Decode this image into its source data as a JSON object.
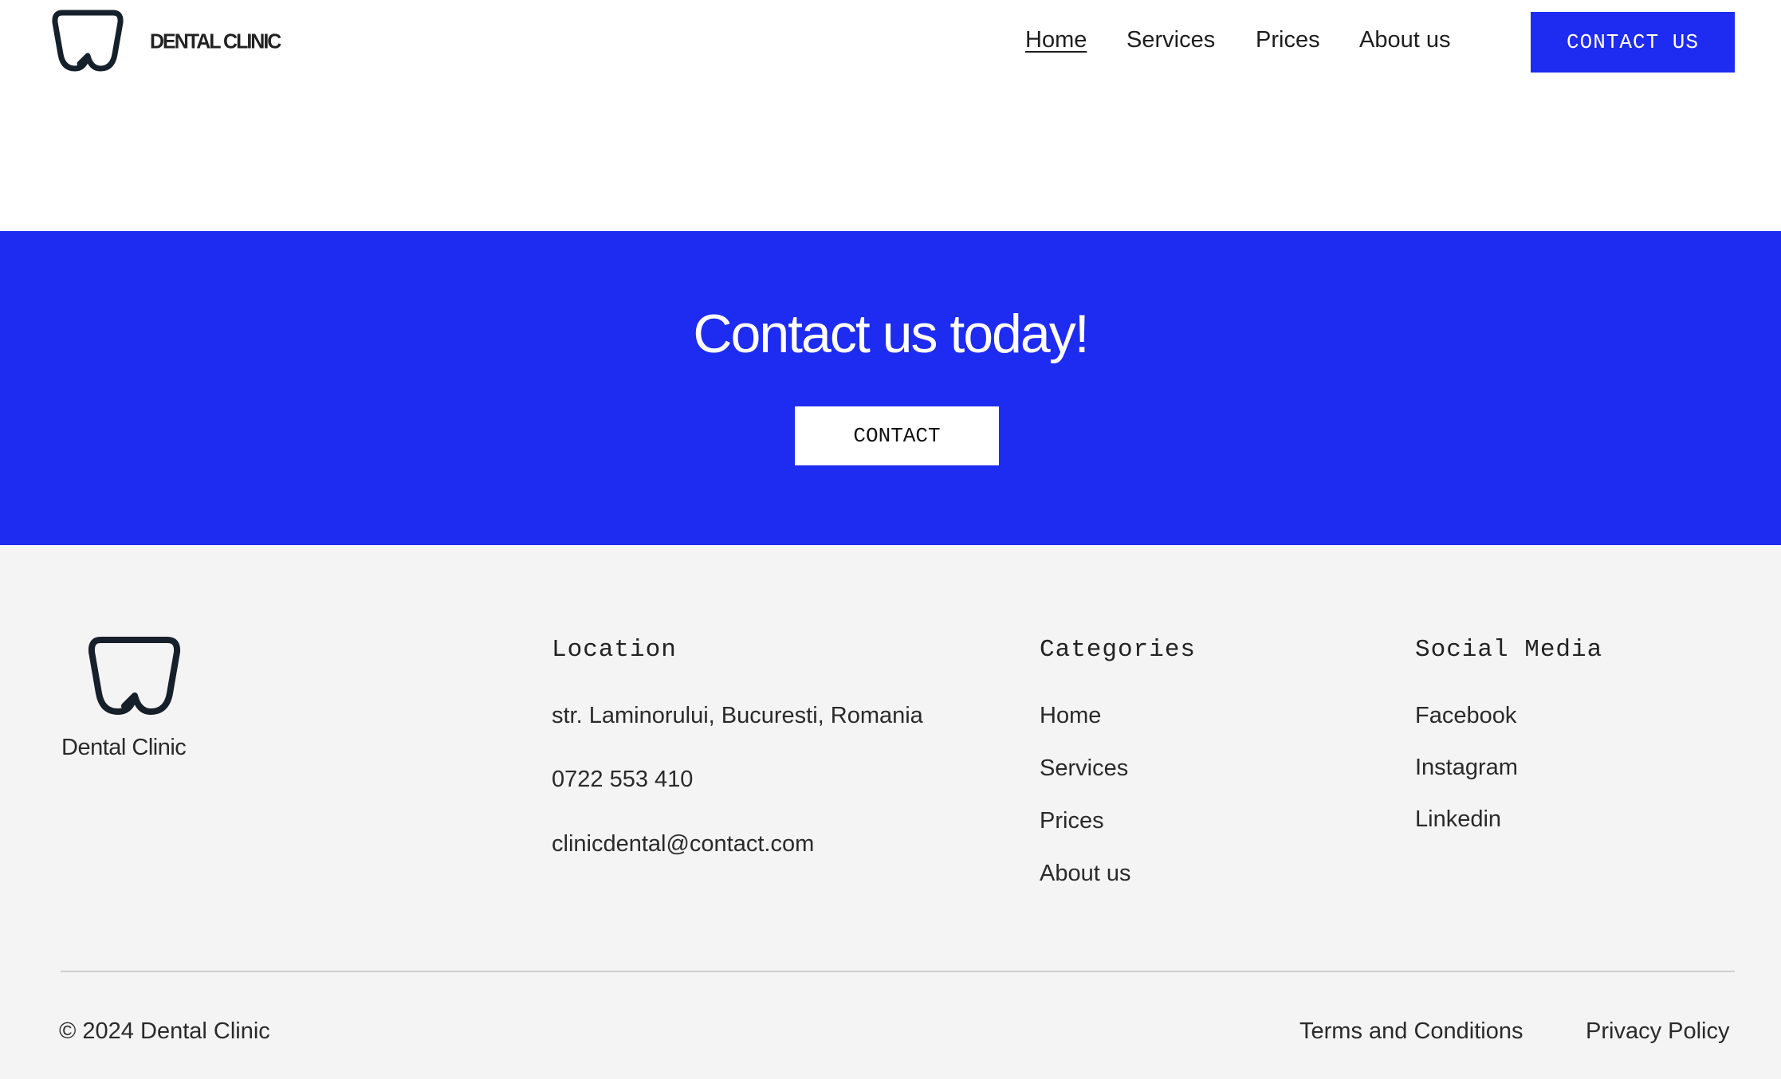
{
  "header": {
    "logo_text": "DENTAL CLINIC",
    "nav": [
      "Home",
      "Services",
      "Prices",
      "About us"
    ],
    "contact_button": "CONTACT  US"
  },
  "cta": {
    "title": "Contact us today!",
    "button": "CONTACT"
  },
  "footer": {
    "brand": "Dental Clinic",
    "location": {
      "title": "Location",
      "address": "str. Laminorului, Bucuresti, Romania",
      "phone": "0722 553 410",
      "email": "clinicdental@contact.com"
    },
    "categories": {
      "title": "Categories",
      "items": [
        "Home",
        "Services",
        "Prices",
        "About us"
      ]
    },
    "social": {
      "title": "Social Media",
      "items": [
        "Facebook",
        "Instagram",
        "Linkedin"
      ]
    },
    "copyright": "© 2024 Dental Clinic",
    "terms": "Terms and Conditions",
    "privacy": "Privacy Policy"
  },
  "colors": {
    "accent": "#1e2bf0",
    "footer_bg": "#f4f4f4",
    "text": "#1e1e1e"
  },
  "icons": {
    "logo": "tooth-icon"
  }
}
